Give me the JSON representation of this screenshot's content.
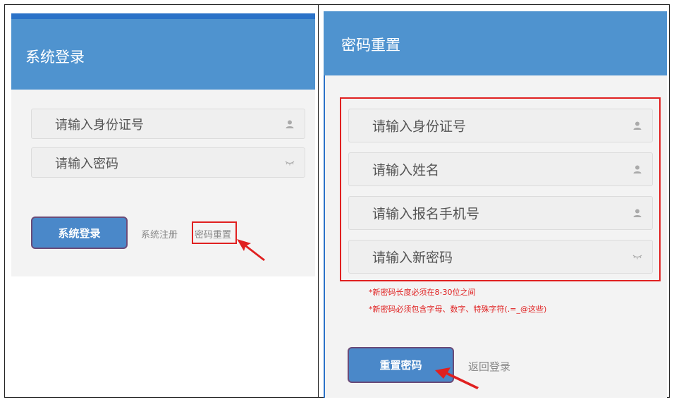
{
  "login_panel": {
    "title": "系统登录",
    "id_placeholder": "请输入身份证号",
    "password_placeholder": "请输入密码",
    "login_button": "系统登录",
    "register_link": "系统注册",
    "reset_link": "密码重置"
  },
  "reset_panel": {
    "title": "密码重置",
    "id_placeholder": "请输入身份证号",
    "name_placeholder": "请输入姓名",
    "phone_placeholder": "请输入报名手机号",
    "new_password_placeholder": "请输入新密码",
    "note_length": "*新密码长度必须在8-30位之间",
    "note_chars": "*新密码必须包含字母、数字、特殊字符(.=_@这些)",
    "reset_button": "重置密码",
    "back_link": "返回登录"
  },
  "colors": {
    "header_blue": "#4f93cf",
    "button_blue": "#4a88c9",
    "highlight_red": "#e02020"
  },
  "icons": {
    "user": "user-icon",
    "eye": "eye-closed-icon",
    "arrow": "red-arrow-icon"
  }
}
